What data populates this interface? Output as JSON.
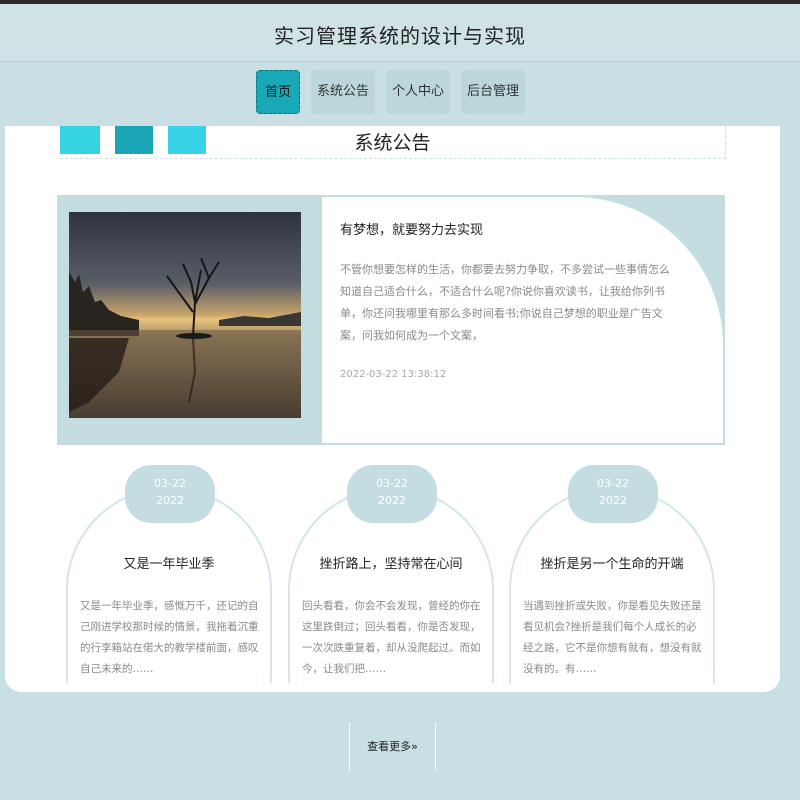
{
  "header": {
    "title": "实习管理系统的设计与实现"
  },
  "nav": {
    "items": [
      {
        "label": "首页",
        "active": true
      },
      {
        "label": "系统公告",
        "active": false
      },
      {
        "label": "个人中心",
        "active": false
      },
      {
        "label": "后台管理",
        "active": false
      }
    ]
  },
  "notices": {
    "section_title": "系统公告",
    "featured": {
      "title": "有梦想，就要努力去实现",
      "excerpt": "不管你想要怎样的生活，你都要去努力争取，不多尝试一些事情怎么知道自己适合什么，不适合什么呢?你说你喜欢读书，让我给你列书单，你还问我哪里有那么多时间看书;你说自己梦想的职业是广告文案，问我如何成为一个文案，",
      "datetime": "2022-03-22 13:38:12"
    },
    "cards": [
      {
        "date_md": "03-22",
        "date_y": "2022",
        "title": "又是一年毕业季",
        "excerpt": "又是一年毕业季，感慨万千，还记的自己刚进学校那时候的情景，我拖着沉重的行李箱站在偌大的教学楼前面，感叹自己未来的……"
      },
      {
        "date_md": "03-22",
        "date_y": "2022",
        "title": "挫折路上，坚持常在心间",
        "excerpt": "回头看看，你会不会发现，曾经的你在这里跌倒过；回头看看，你是否发现，一次次跌重复着，却从没爬起过。而如今，让我们把……"
      },
      {
        "date_md": "03-22",
        "date_y": "2022",
        "title": "挫折是另一个生命的开端",
        "excerpt": "当遇到挫折或失败，你是看见失败还是看见机会?挫折是我们每个人成长的必经之路，它不是你想有就有，想没有就没有的。有……"
      }
    ]
  },
  "more_link": "查看更多"
}
